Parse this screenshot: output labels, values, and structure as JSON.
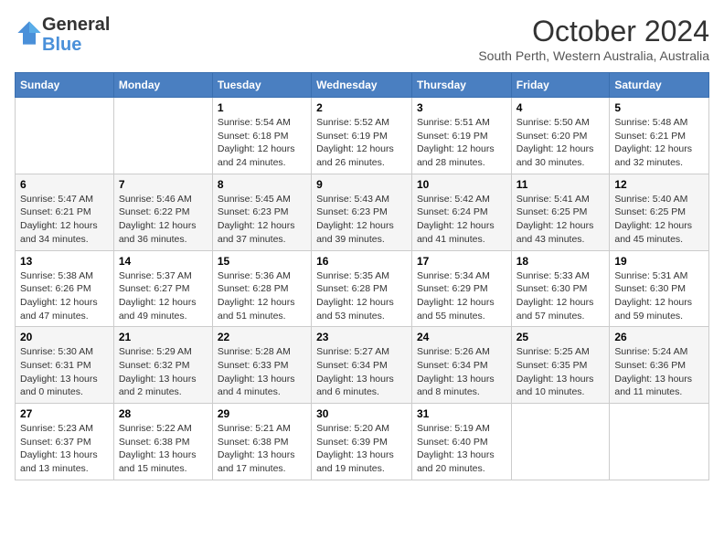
{
  "header": {
    "logo_general": "General",
    "logo_blue": "Blue",
    "month_title": "October 2024",
    "subtitle": "South Perth, Western Australia, Australia"
  },
  "days_of_week": [
    "Sunday",
    "Monday",
    "Tuesday",
    "Wednesday",
    "Thursday",
    "Friday",
    "Saturday"
  ],
  "weeks": [
    [
      {
        "day": "",
        "info": ""
      },
      {
        "day": "",
        "info": ""
      },
      {
        "day": "1",
        "info": "Sunrise: 5:54 AM\nSunset: 6:18 PM\nDaylight: 12 hours and 24 minutes."
      },
      {
        "day": "2",
        "info": "Sunrise: 5:52 AM\nSunset: 6:19 PM\nDaylight: 12 hours and 26 minutes."
      },
      {
        "day": "3",
        "info": "Sunrise: 5:51 AM\nSunset: 6:19 PM\nDaylight: 12 hours and 28 minutes."
      },
      {
        "day": "4",
        "info": "Sunrise: 5:50 AM\nSunset: 6:20 PM\nDaylight: 12 hours and 30 minutes."
      },
      {
        "day": "5",
        "info": "Sunrise: 5:48 AM\nSunset: 6:21 PM\nDaylight: 12 hours and 32 minutes."
      }
    ],
    [
      {
        "day": "6",
        "info": "Sunrise: 5:47 AM\nSunset: 6:21 PM\nDaylight: 12 hours and 34 minutes."
      },
      {
        "day": "7",
        "info": "Sunrise: 5:46 AM\nSunset: 6:22 PM\nDaylight: 12 hours and 36 minutes."
      },
      {
        "day": "8",
        "info": "Sunrise: 5:45 AM\nSunset: 6:23 PM\nDaylight: 12 hours and 37 minutes."
      },
      {
        "day": "9",
        "info": "Sunrise: 5:43 AM\nSunset: 6:23 PM\nDaylight: 12 hours and 39 minutes."
      },
      {
        "day": "10",
        "info": "Sunrise: 5:42 AM\nSunset: 6:24 PM\nDaylight: 12 hours and 41 minutes."
      },
      {
        "day": "11",
        "info": "Sunrise: 5:41 AM\nSunset: 6:25 PM\nDaylight: 12 hours and 43 minutes."
      },
      {
        "day": "12",
        "info": "Sunrise: 5:40 AM\nSunset: 6:25 PM\nDaylight: 12 hours and 45 minutes."
      }
    ],
    [
      {
        "day": "13",
        "info": "Sunrise: 5:38 AM\nSunset: 6:26 PM\nDaylight: 12 hours and 47 minutes."
      },
      {
        "day": "14",
        "info": "Sunrise: 5:37 AM\nSunset: 6:27 PM\nDaylight: 12 hours and 49 minutes."
      },
      {
        "day": "15",
        "info": "Sunrise: 5:36 AM\nSunset: 6:28 PM\nDaylight: 12 hours and 51 minutes."
      },
      {
        "day": "16",
        "info": "Sunrise: 5:35 AM\nSunset: 6:28 PM\nDaylight: 12 hours and 53 minutes."
      },
      {
        "day": "17",
        "info": "Sunrise: 5:34 AM\nSunset: 6:29 PM\nDaylight: 12 hours and 55 minutes."
      },
      {
        "day": "18",
        "info": "Sunrise: 5:33 AM\nSunset: 6:30 PM\nDaylight: 12 hours and 57 minutes."
      },
      {
        "day": "19",
        "info": "Sunrise: 5:31 AM\nSunset: 6:30 PM\nDaylight: 12 hours and 59 minutes."
      }
    ],
    [
      {
        "day": "20",
        "info": "Sunrise: 5:30 AM\nSunset: 6:31 PM\nDaylight: 13 hours and 0 minutes."
      },
      {
        "day": "21",
        "info": "Sunrise: 5:29 AM\nSunset: 6:32 PM\nDaylight: 13 hours and 2 minutes."
      },
      {
        "day": "22",
        "info": "Sunrise: 5:28 AM\nSunset: 6:33 PM\nDaylight: 13 hours and 4 minutes."
      },
      {
        "day": "23",
        "info": "Sunrise: 5:27 AM\nSunset: 6:34 PM\nDaylight: 13 hours and 6 minutes."
      },
      {
        "day": "24",
        "info": "Sunrise: 5:26 AM\nSunset: 6:34 PM\nDaylight: 13 hours and 8 minutes."
      },
      {
        "day": "25",
        "info": "Sunrise: 5:25 AM\nSunset: 6:35 PM\nDaylight: 13 hours and 10 minutes."
      },
      {
        "day": "26",
        "info": "Sunrise: 5:24 AM\nSunset: 6:36 PM\nDaylight: 13 hours and 11 minutes."
      }
    ],
    [
      {
        "day": "27",
        "info": "Sunrise: 5:23 AM\nSunset: 6:37 PM\nDaylight: 13 hours and 13 minutes."
      },
      {
        "day": "28",
        "info": "Sunrise: 5:22 AM\nSunset: 6:38 PM\nDaylight: 13 hours and 15 minutes."
      },
      {
        "day": "29",
        "info": "Sunrise: 5:21 AM\nSunset: 6:38 PM\nDaylight: 13 hours and 17 minutes."
      },
      {
        "day": "30",
        "info": "Sunrise: 5:20 AM\nSunset: 6:39 PM\nDaylight: 13 hours and 19 minutes."
      },
      {
        "day": "31",
        "info": "Sunrise: 5:19 AM\nSunset: 6:40 PM\nDaylight: 13 hours and 20 minutes."
      },
      {
        "day": "",
        "info": ""
      },
      {
        "day": "",
        "info": ""
      }
    ]
  ]
}
